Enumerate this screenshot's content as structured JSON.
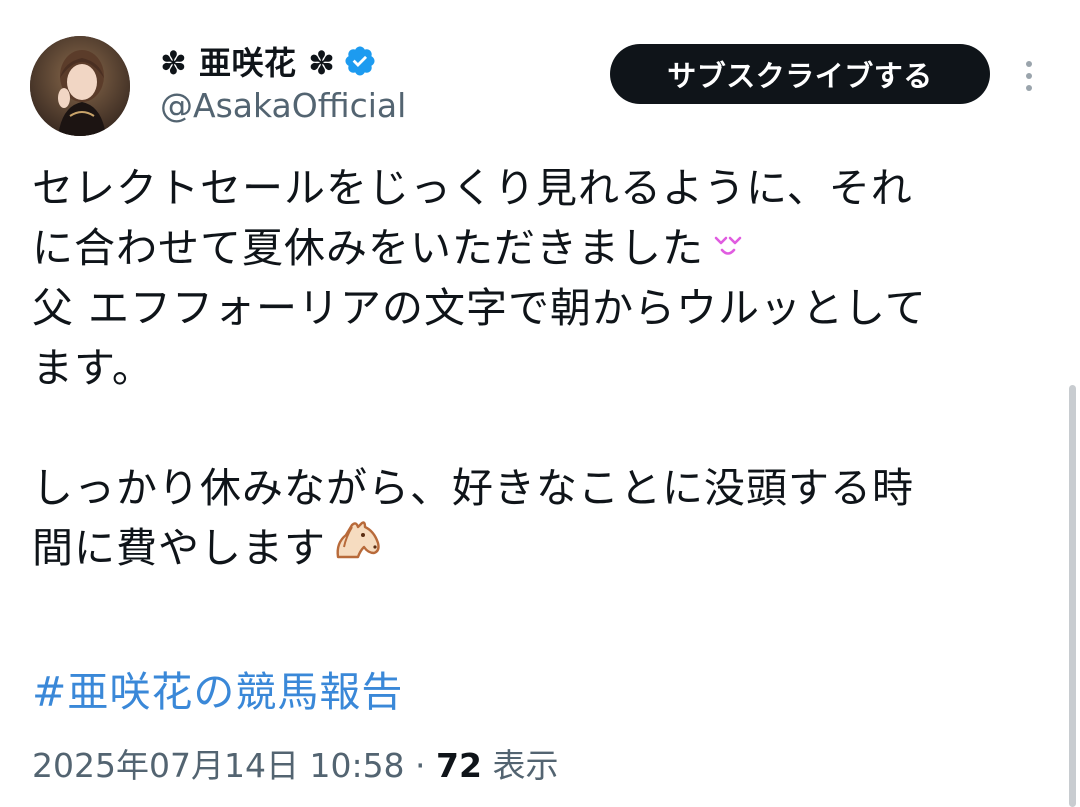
{
  "author": {
    "display_name": "✽ 亜咲花 ✽",
    "handle": "@AsakaOfficial",
    "verified_icon": "verified-badge-icon",
    "avatar_icon": "profile-photo"
  },
  "actions": {
    "subscribe_label": "サブスクライブする",
    "more_icon": "more-vertical-icon"
  },
  "tweet": {
    "lines": [
      "セレクトセールをじっくり見れるように、それ",
      "に合わせて夏休みをいただきました",
      "父 エフフォーリアの文字で朝からウルッとして",
      "ます。",
      "",
      "しっかり休みながら、好きなことに没頭する時",
      "間に費やします"
    ],
    "emoji_1": "smiling-face-icon",
    "emoji_2": "horse-face-icon",
    "hashtag": "#亜咲花の競馬報告"
  },
  "meta": {
    "datetime": "2025年07月14日 10:58",
    "separator": " · ",
    "views_count": "72",
    "views_label": " 表示"
  },
  "colors": {
    "text": "#0f1419",
    "secondary": "#536471",
    "link": "#3a88d8",
    "verified": "#1d9bf0",
    "button_bg": "#0f1419"
  }
}
